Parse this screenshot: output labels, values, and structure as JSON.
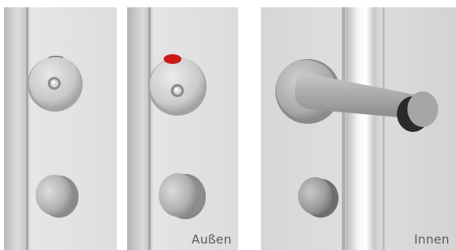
{
  "panels": [
    {
      "id": "lock-closed",
      "caption": ""
    },
    {
      "id": "lock-outside",
      "caption": "Außen"
    },
    {
      "id": "lock-inside",
      "caption": "Innen"
    }
  ],
  "colors": {
    "indicator_red": "#cc1a1a",
    "steel": "#b5b5b5",
    "door_panel": "#e3e3e3",
    "frame_shadow": "#8c8c8c"
  }
}
